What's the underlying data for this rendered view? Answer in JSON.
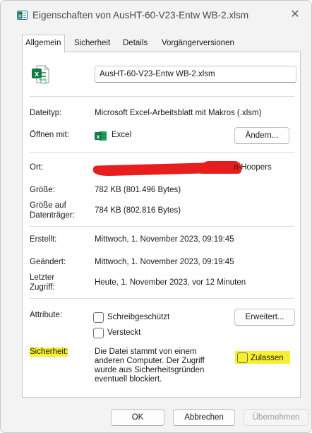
{
  "window": {
    "title": "Eigenschaften von AusHT-60-V23-Entw WB-2.xlsm",
    "close_glyph": "✕"
  },
  "tabs": [
    {
      "label": "Allgemein",
      "active": true
    },
    {
      "label": "Sicherheit",
      "active": false
    },
    {
      "label": "Details",
      "active": false
    },
    {
      "label": "Vorgängerversionen",
      "active": false
    }
  ],
  "file": {
    "icon": "excel-file-icon",
    "name_value": "AusHT-60-V23-Entw WB-2.xlsm"
  },
  "fields": {
    "type_label": "Dateityp:",
    "type_value": "Microsoft Excel-Arbeitsblatt mit Makros (.xlsm)",
    "opens_label": "Öffnen mit:",
    "opens_value": "Excel",
    "change_button": "Ändern...",
    "location_label": "Ort:",
    "location_value_visible": "n-Hoopers",
    "size_label": "Größe:",
    "size_value": "782 KB (801.496 Bytes)",
    "disk_size_label_1": "Größe auf",
    "disk_size_label_2": "Datenträger:",
    "disk_size_value": "784 KB (802.816 Bytes)",
    "created_label": "Erstellt:",
    "created_value": "Mittwoch, 1. November 2023, 09:19:45",
    "modified_label": "Geändert:",
    "modified_value": "Mittwoch, 1. November 2023, 09:19:45",
    "accessed_label_1": "Letzter",
    "accessed_label_2": "Zugriff:",
    "accessed_value": "Heute, 1. November 2023, vor 12 Minuten",
    "attributes_label": "Attribute:",
    "readonly_label": "Schreibgeschützt",
    "hidden_label": "Versteckt",
    "advanced_button": "Erweitert...",
    "security_label": "Sicherheit:",
    "security_text_1": "Die Datei stammt von einem",
    "security_text_2": "anderen Computer. Der Zugriff",
    "security_text_3": "wurde aus Sicherheitsgründen",
    "security_text_4": "eventuell blockiert.",
    "unblock_label": "Zulassen"
  },
  "buttons": {
    "ok": "OK",
    "cancel": "Abbrechen",
    "apply": "Übernehmen"
  },
  "colors": {
    "excel_green": "#107c41",
    "highlight_yellow": "#f7ef2f",
    "redaction_red": "#e81e1e"
  }
}
